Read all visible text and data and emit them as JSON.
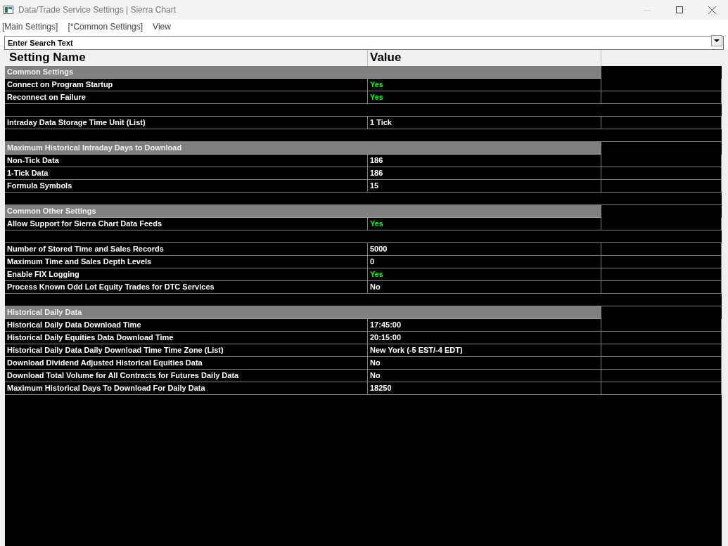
{
  "window": {
    "title": "Data/Trade Service Settings | Sierra Chart"
  },
  "menu": [
    "[Main Settings]",
    "[*Common Settings]",
    "View"
  ],
  "search": {
    "placeholder": "Enter Search Text"
  },
  "table": {
    "columns": [
      "Setting Name",
      "Value"
    ],
    "rows": [
      {
        "kind": "section",
        "name": "Common Settings"
      },
      {
        "kind": "setting",
        "name": "Connect on Program Startup",
        "value": "Yes",
        "color": "#00ff00"
      },
      {
        "kind": "setting",
        "name": "Reconnect on Failure",
        "value": "Yes",
        "color": "#00ff00"
      },
      {
        "kind": "blank"
      },
      {
        "kind": "setting",
        "name": "Intraday Data Storage Time Unit (List)",
        "value": "1 Tick",
        "color": "#ffffff"
      },
      {
        "kind": "blank"
      },
      {
        "kind": "section",
        "name": "Maximum Historical Intraday Days to Download"
      },
      {
        "kind": "setting",
        "name": "Non-Tick Data",
        "value": "186",
        "color": "#ffffff"
      },
      {
        "kind": "setting",
        "name": "1-Tick Data",
        "value": "186",
        "color": "#ffffff"
      },
      {
        "kind": "setting",
        "name": "Formula Symbols",
        "value": "15",
        "color": "#ffffff"
      },
      {
        "kind": "blank"
      },
      {
        "kind": "section",
        "name": "Common Other Settings"
      },
      {
        "kind": "setting",
        "name": "Allow Support for Sierra Chart Data Feeds",
        "value": "Yes",
        "color": "#00ff00"
      },
      {
        "kind": "blank"
      },
      {
        "kind": "setting",
        "name": "Number of Stored Time and Sales Records",
        "value": "5000",
        "color": "#ffffff"
      },
      {
        "kind": "setting",
        "name": "Maximum Time and Sales Depth Levels",
        "value": "0",
        "color": "#ffffff"
      },
      {
        "kind": "setting",
        "name": "Enable FIX Logging",
        "value": "Yes",
        "color": "#00ff00"
      },
      {
        "kind": "setting",
        "name": "Process Known Odd Lot Equity Trades for DTC Services",
        "value": "No",
        "color": "#ffffff"
      },
      {
        "kind": "blank"
      },
      {
        "kind": "section",
        "name": "Historical Daily Data"
      },
      {
        "kind": "setting",
        "name": "Historical Daily Data Download Time",
        "value": "17:45:00",
        "color": "#ffffff"
      },
      {
        "kind": "setting",
        "name": "Historical Daily Equities Data Download Time",
        "value": "20:15:00",
        "color": "#ffffff"
      },
      {
        "kind": "setting",
        "name": "Historical Daily Data Daily Download Time Time Zone (List)",
        "value": "New York (-5 EST/-4 EDT)",
        "color": "#ffffff"
      },
      {
        "kind": "setting",
        "name": "Download Dividend Adjusted Historical Equities Data",
        "value": "No",
        "color": "#ffffff"
      },
      {
        "kind": "setting",
        "name": "Download Total Volume for All Contracts for Futures Daily Data",
        "value": "No",
        "color": "#ffffff"
      },
      {
        "kind": "setting",
        "name": "Maximum Historical Days To Download For Daily Data",
        "value": "18250",
        "color": "#ffffff"
      }
    ]
  }
}
